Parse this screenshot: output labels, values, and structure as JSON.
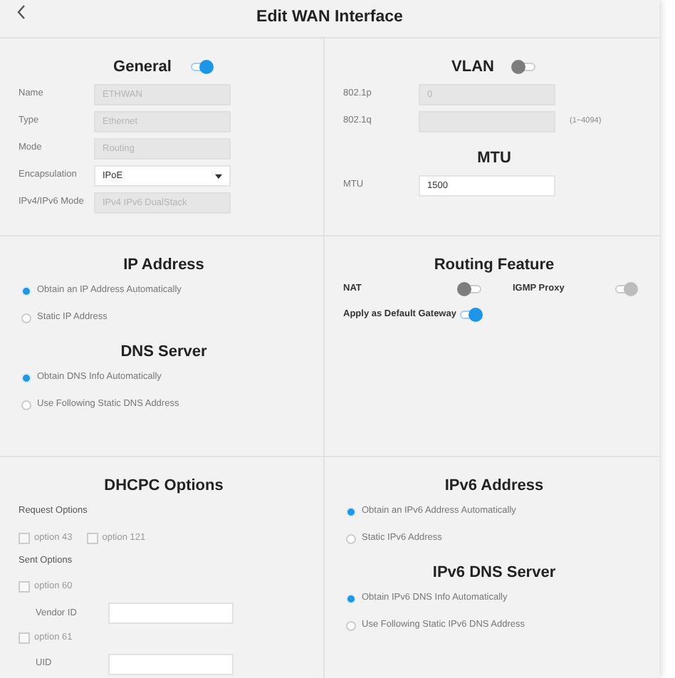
{
  "title": "Edit WAN Interface",
  "panels": [
    {
      "blocks": [
        {
          "kind": "heading",
          "text": "General",
          "toggle": {
            "on": true,
            "disabled": false
          }
        },
        {
          "kind": "field",
          "label": "Name",
          "value": "ETHWAN",
          "readonly": true
        },
        {
          "kind": "field",
          "label": "Type",
          "value": "Ethernet",
          "readonly": true
        },
        {
          "kind": "field",
          "label": "Mode",
          "value": "Routing",
          "readonly": true
        },
        {
          "kind": "select",
          "label": "Encapsulation",
          "value": "IPoE"
        },
        {
          "kind": "field",
          "label": "IPv4/IPv6 Mode",
          "value": "IPv4 IPv6 DualStack",
          "readonly": true
        }
      ]
    },
    {
      "blocks": [
        {
          "kind": "heading",
          "text": "VLAN",
          "toggle": {
            "on": false,
            "disabled": false
          }
        },
        {
          "kind": "field",
          "label": "802.1p",
          "value": "0",
          "readonly": true
        },
        {
          "kind": "field",
          "label": "802.1q",
          "readonly": true,
          "hint": "(1~4094)"
        },
        {
          "kind": "heading",
          "text": "MTU"
        },
        {
          "kind": "field",
          "label": "MTU",
          "value": "1500",
          "readonly": false
        }
      ]
    },
    {
      "blocks": [
        {
          "kind": "heading",
          "text": "IP Address"
        },
        {
          "kind": "radio",
          "label": "Obtain an IP Address Automatically",
          "selected": true
        },
        {
          "kind": "radio",
          "label": "Static IP Address",
          "selected": false
        },
        {
          "kind": "heading",
          "text": "DNS Server"
        },
        {
          "kind": "radio",
          "label": "Obtain DNS Info Automatically",
          "selected": true
        },
        {
          "kind": "radio",
          "label": "Use Following Static DNS Address",
          "selected": false
        }
      ]
    },
    {
      "blocks": [
        {
          "kind": "heading",
          "text": "Routing Feature"
        },
        {
          "kind": "switches",
          "items": [
            {
              "label": "NAT",
              "on": false,
              "disabled": false
            },
            {
              "label": "IGMP Proxy",
              "on": true,
              "disabled": true
            }
          ]
        },
        {
          "kind": "switches",
          "items": [
            {
              "label": "Apply as Default Gateway",
              "on": true,
              "disabled": false
            }
          ]
        }
      ]
    },
    {
      "blocks": [
        {
          "kind": "heading",
          "text": "DHCPC Options"
        },
        {
          "kind": "subhead",
          "text": "Request Options"
        },
        {
          "kind": "checks",
          "items": [
            {
              "label": "option 43",
              "checked": false
            },
            {
              "label": "option 121",
              "checked": false
            }
          ]
        },
        {
          "kind": "subhead",
          "text": "Sent Options"
        },
        {
          "kind": "checks",
          "items": [
            {
              "label": "option 60",
              "checked": false
            }
          ]
        },
        {
          "kind": "subfield",
          "label": "Vendor ID"
        },
        {
          "kind": "checks",
          "items": [
            {
              "label": "option 61",
              "checked": false
            }
          ]
        },
        {
          "kind": "subfield",
          "label": "UID"
        }
      ]
    },
    {
      "blocks": [
        {
          "kind": "heading",
          "text": "IPv6 Address"
        },
        {
          "kind": "radio",
          "label": "Obtain an IPv6 Address Automatically",
          "selected": true
        },
        {
          "kind": "radio",
          "label": "Static IPv6 Address",
          "selected": false
        },
        {
          "kind": "heading",
          "text": "IPv6 DNS Server"
        },
        {
          "kind": "radio",
          "label": "Obtain IPv6 DNS Info Automatically",
          "selected": true
        },
        {
          "kind": "radio",
          "label": "Use Following Static IPv6 DNS Address",
          "selected": false
        }
      ]
    }
  ]
}
